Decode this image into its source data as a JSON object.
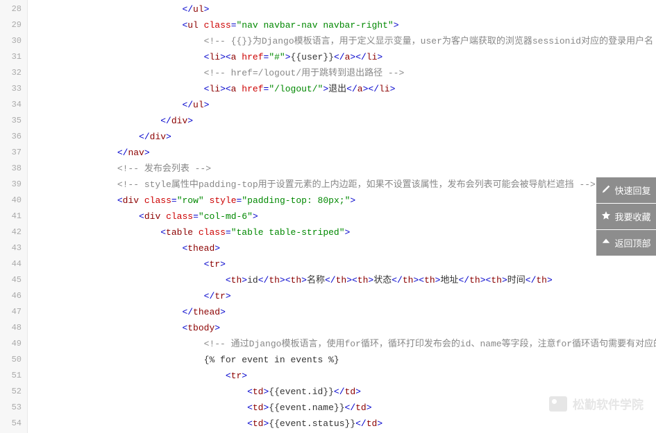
{
  "lines": [
    {
      "num": 28,
      "indent": 7,
      "tokens": [
        {
          "c": "tag-bracket",
          "t": "</"
        },
        {
          "c": "tag-name",
          "t": "ul"
        },
        {
          "c": "tag-bracket",
          "t": ">"
        }
      ]
    },
    {
      "num": 29,
      "indent": 7,
      "tokens": [
        {
          "c": "tag-bracket",
          "t": "<"
        },
        {
          "c": "tag-name",
          "t": "ul"
        },
        {
          "c": "",
          "t": " "
        },
        {
          "c": "attr-name",
          "t": "class"
        },
        {
          "c": "attr-eq",
          "t": "="
        },
        {
          "c": "attr-val",
          "t": "\"nav navbar-nav navbar-right\""
        },
        {
          "c": "tag-bracket",
          "t": ">"
        }
      ]
    },
    {
      "num": 30,
      "indent": 8,
      "tokens": [
        {
          "c": "comment",
          "t": "<!-- {{}}为Django模板语言，用于定义显示变量，user为客户端获取的浏览器sessionid对应的登录用户名 -->"
        }
      ]
    },
    {
      "num": 31,
      "indent": 8,
      "tokens": [
        {
          "c": "tag-bracket",
          "t": "<"
        },
        {
          "c": "tag-name",
          "t": "li"
        },
        {
          "c": "tag-bracket",
          "t": "><"
        },
        {
          "c": "tag-name",
          "t": "a"
        },
        {
          "c": "",
          "t": " "
        },
        {
          "c": "attr-name",
          "t": "href"
        },
        {
          "c": "attr-eq",
          "t": "="
        },
        {
          "c": "attr-val",
          "t": "\"#\""
        },
        {
          "c": "tag-bracket",
          "t": ">"
        },
        {
          "c": "text-dark",
          "t": "{{user}}"
        },
        {
          "c": "tag-bracket",
          "t": "</"
        },
        {
          "c": "tag-name",
          "t": "a"
        },
        {
          "c": "tag-bracket",
          "t": "></"
        },
        {
          "c": "tag-name",
          "t": "li"
        },
        {
          "c": "tag-bracket",
          "t": ">"
        }
      ]
    },
    {
      "num": 32,
      "indent": 8,
      "tokens": [
        {
          "c": "comment",
          "t": "<!-- href=/logout/用于跳转到退出路径 -->"
        }
      ]
    },
    {
      "num": 33,
      "indent": 8,
      "tokens": [
        {
          "c": "tag-bracket",
          "t": "<"
        },
        {
          "c": "tag-name",
          "t": "li"
        },
        {
          "c": "tag-bracket",
          "t": "><"
        },
        {
          "c": "tag-name",
          "t": "a"
        },
        {
          "c": "",
          "t": " "
        },
        {
          "c": "attr-name",
          "t": "href"
        },
        {
          "c": "attr-eq",
          "t": "="
        },
        {
          "c": "attr-val",
          "t": "\"/logout/\""
        },
        {
          "c": "tag-bracket",
          "t": ">"
        },
        {
          "c": "text-dark",
          "t": "退出"
        },
        {
          "c": "tag-bracket",
          "t": "</"
        },
        {
          "c": "tag-name",
          "t": "a"
        },
        {
          "c": "tag-bracket",
          "t": "></"
        },
        {
          "c": "tag-name",
          "t": "li"
        },
        {
          "c": "tag-bracket",
          "t": ">"
        }
      ]
    },
    {
      "num": 34,
      "indent": 7,
      "tokens": [
        {
          "c": "tag-bracket",
          "t": "</"
        },
        {
          "c": "tag-name",
          "t": "ul"
        },
        {
          "c": "tag-bracket",
          "t": ">"
        }
      ]
    },
    {
      "num": 35,
      "indent": 6,
      "tokens": [
        {
          "c": "tag-bracket",
          "t": "</"
        },
        {
          "c": "tag-name",
          "t": "div"
        },
        {
          "c": "tag-bracket",
          "t": ">"
        }
      ]
    },
    {
      "num": 36,
      "indent": 5,
      "tokens": [
        {
          "c": "tag-bracket",
          "t": "</"
        },
        {
          "c": "tag-name",
          "t": "div"
        },
        {
          "c": "tag-bracket",
          "t": ">"
        }
      ]
    },
    {
      "num": 37,
      "indent": 4,
      "tokens": [
        {
          "c": "tag-bracket",
          "t": "</"
        },
        {
          "c": "tag-name",
          "t": "nav"
        },
        {
          "c": "tag-bracket",
          "t": ">"
        }
      ]
    },
    {
      "num": 38,
      "indent": 4,
      "tokens": [
        {
          "c": "comment",
          "t": "<!-- 发布会列表 -->"
        }
      ]
    },
    {
      "num": 39,
      "indent": 4,
      "tokens": [
        {
          "c": "comment",
          "t": "<!-- style属性中padding-top用于设置元素的上内边距，如果不设置该属性，发布会列表可能会被导航栏遮挡 -->"
        }
      ]
    },
    {
      "num": 40,
      "indent": 4,
      "tokens": [
        {
          "c": "tag-bracket",
          "t": "<"
        },
        {
          "c": "tag-name",
          "t": "div"
        },
        {
          "c": "",
          "t": " "
        },
        {
          "c": "attr-name",
          "t": "class"
        },
        {
          "c": "attr-eq",
          "t": "="
        },
        {
          "c": "attr-val",
          "t": "\"row\""
        },
        {
          "c": "",
          "t": " "
        },
        {
          "c": "attr-name",
          "t": "style"
        },
        {
          "c": "attr-eq",
          "t": "="
        },
        {
          "c": "attr-val",
          "t": "\"padding-top: 80px;\""
        },
        {
          "c": "tag-bracket",
          "t": ">"
        }
      ]
    },
    {
      "num": 41,
      "indent": 5,
      "tokens": [
        {
          "c": "tag-bracket",
          "t": "<"
        },
        {
          "c": "tag-name",
          "t": "div"
        },
        {
          "c": "",
          "t": " "
        },
        {
          "c": "attr-name",
          "t": "class"
        },
        {
          "c": "attr-eq",
          "t": "="
        },
        {
          "c": "attr-val",
          "t": "\"col-md-6\""
        },
        {
          "c": "tag-bracket",
          "t": ">"
        }
      ]
    },
    {
      "num": 42,
      "indent": 6,
      "tokens": [
        {
          "c": "tag-bracket",
          "t": "<"
        },
        {
          "c": "tag-name",
          "t": "table"
        },
        {
          "c": "",
          "t": " "
        },
        {
          "c": "attr-name",
          "t": "class"
        },
        {
          "c": "attr-eq",
          "t": "="
        },
        {
          "c": "attr-val",
          "t": "\"table table-striped\""
        },
        {
          "c": "tag-bracket",
          "t": ">"
        }
      ]
    },
    {
      "num": 43,
      "indent": 7,
      "tokens": [
        {
          "c": "tag-bracket",
          "t": "<"
        },
        {
          "c": "tag-name",
          "t": "thead"
        },
        {
          "c": "tag-bracket",
          "t": ">"
        }
      ]
    },
    {
      "num": 44,
      "indent": 8,
      "tokens": [
        {
          "c": "tag-bracket",
          "t": "<"
        },
        {
          "c": "tag-name",
          "t": "tr"
        },
        {
          "c": "tag-bracket",
          "t": ">"
        }
      ]
    },
    {
      "num": 45,
      "indent": 9,
      "tokens": [
        {
          "c": "tag-bracket",
          "t": "<"
        },
        {
          "c": "tag-name",
          "t": "th"
        },
        {
          "c": "tag-bracket",
          "t": ">"
        },
        {
          "c": "text-dark",
          "t": "id"
        },
        {
          "c": "tag-bracket",
          "t": "</"
        },
        {
          "c": "tag-name",
          "t": "th"
        },
        {
          "c": "tag-bracket",
          "t": "><"
        },
        {
          "c": "tag-name",
          "t": "th"
        },
        {
          "c": "tag-bracket",
          "t": ">"
        },
        {
          "c": "text-dark",
          "t": "名称"
        },
        {
          "c": "tag-bracket",
          "t": "</"
        },
        {
          "c": "tag-name",
          "t": "th"
        },
        {
          "c": "tag-bracket",
          "t": "><"
        },
        {
          "c": "tag-name",
          "t": "th"
        },
        {
          "c": "tag-bracket",
          "t": ">"
        },
        {
          "c": "text-dark",
          "t": "状态"
        },
        {
          "c": "tag-bracket",
          "t": "</"
        },
        {
          "c": "tag-name",
          "t": "th"
        },
        {
          "c": "tag-bracket",
          "t": "><"
        },
        {
          "c": "tag-name",
          "t": "th"
        },
        {
          "c": "tag-bracket",
          "t": ">"
        },
        {
          "c": "text-dark",
          "t": "地址"
        },
        {
          "c": "tag-bracket",
          "t": "</"
        },
        {
          "c": "tag-name",
          "t": "th"
        },
        {
          "c": "tag-bracket",
          "t": "><"
        },
        {
          "c": "tag-name",
          "t": "th"
        },
        {
          "c": "tag-bracket",
          "t": ">"
        },
        {
          "c": "text-dark",
          "t": "时间"
        },
        {
          "c": "tag-bracket",
          "t": "</"
        },
        {
          "c": "tag-name",
          "t": "th"
        },
        {
          "c": "tag-bracket",
          "t": ">"
        }
      ]
    },
    {
      "num": 46,
      "indent": 8,
      "tokens": [
        {
          "c": "tag-bracket",
          "t": "</"
        },
        {
          "c": "tag-name",
          "t": "tr"
        },
        {
          "c": "tag-bracket",
          "t": ">"
        }
      ]
    },
    {
      "num": 47,
      "indent": 7,
      "tokens": [
        {
          "c": "tag-bracket",
          "t": "</"
        },
        {
          "c": "tag-name",
          "t": "thead"
        },
        {
          "c": "tag-bracket",
          "t": ">"
        }
      ]
    },
    {
      "num": 48,
      "indent": 7,
      "tokens": [
        {
          "c": "tag-bracket",
          "t": "<"
        },
        {
          "c": "tag-name",
          "t": "tbody"
        },
        {
          "c": "tag-bracket",
          "t": ">"
        }
      ]
    },
    {
      "num": 49,
      "indent": 8,
      "tokens": [
        {
          "c": "comment",
          "t": "<!-- 通过Django模板语言，使用for循环，循环打印发布会的id、name等字段，注意for循环语句需要有对应的endfor来表示语句的"
        }
      ]
    },
    {
      "num": 50,
      "indent": 8,
      "tokens": [
        {
          "c": "text-dark",
          "t": "{% for event in events %}"
        }
      ]
    },
    {
      "num": 51,
      "indent": 9,
      "tokens": [
        {
          "c": "tag-bracket",
          "t": "<"
        },
        {
          "c": "tag-name",
          "t": "tr"
        },
        {
          "c": "tag-bracket",
          "t": ">"
        }
      ]
    },
    {
      "num": 52,
      "indent": 10,
      "tokens": [
        {
          "c": "tag-bracket",
          "t": "<"
        },
        {
          "c": "tag-name",
          "t": "td"
        },
        {
          "c": "tag-bracket",
          "t": ">"
        },
        {
          "c": "text-dark",
          "t": "{{event.id}}"
        },
        {
          "c": "tag-bracket",
          "t": "</"
        },
        {
          "c": "tag-name",
          "t": "td"
        },
        {
          "c": "tag-bracket",
          "t": ">"
        }
      ]
    },
    {
      "num": 53,
      "indent": 10,
      "tokens": [
        {
          "c": "tag-bracket",
          "t": "<"
        },
        {
          "c": "tag-name",
          "t": "td"
        },
        {
          "c": "tag-bracket",
          "t": ">"
        },
        {
          "c": "text-dark",
          "t": "{{event.name}}"
        },
        {
          "c": "tag-bracket",
          "t": "</"
        },
        {
          "c": "tag-name",
          "t": "td"
        },
        {
          "c": "tag-bracket",
          "t": ">"
        }
      ]
    },
    {
      "num": 54,
      "indent": 10,
      "tokens": [
        {
          "c": "tag-bracket",
          "t": "<"
        },
        {
          "c": "tag-name",
          "t": "td"
        },
        {
          "c": "tag-bracket",
          "t": ">"
        },
        {
          "c": "text-dark",
          "t": "{{event.status}}"
        },
        {
          "c": "tag-bracket",
          "t": "</"
        },
        {
          "c": "tag-name",
          "t": "td"
        },
        {
          "c": "tag-bracket",
          "t": ">"
        }
      ]
    }
  ],
  "floatButtons": [
    {
      "id": "quick-reply",
      "icon": "pencil",
      "label": "快速回复"
    },
    {
      "id": "favorite",
      "icon": "star",
      "label": "我要收藏"
    },
    {
      "id": "back-top",
      "icon": "up",
      "label": "返回顶部"
    }
  ],
  "watermark": {
    "text": "松勤软件学院"
  }
}
